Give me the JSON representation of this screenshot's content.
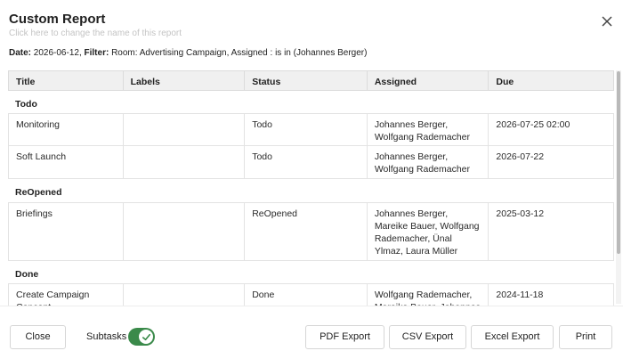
{
  "dialog": {
    "title": "Custom Report",
    "subtitle": "Click here to change the name of this report",
    "close_icon": "close-icon"
  },
  "filter": {
    "date_label": "Date:",
    "date_value": "2026-06-12,",
    "filter_label": "Filter:",
    "filter_value": "Room: Advertising Campaign, Assigned : is in (Johannes Berger)"
  },
  "table": {
    "columns": [
      "Title",
      "Labels",
      "Status",
      "Assigned",
      "Due"
    ],
    "groups": [
      {
        "name": "Todo",
        "rows": [
          {
            "title": "Monitoring",
            "labels": "",
            "status": "Todo",
            "assigned": "Johannes Berger, Wolfgang Rademacher",
            "due": "2026-07-25 02:00"
          },
          {
            "title": "Soft Launch",
            "labels": "",
            "status": "Todo",
            "assigned": "Johannes Berger, Wolfgang Rademacher",
            "due": "2026-07-22"
          }
        ]
      },
      {
        "name": "ReOpened",
        "rows": [
          {
            "title": "Briefings",
            "labels": "",
            "status": "ReOpened",
            "assigned": "Johannes Berger, Mareike Bauer, Wolfgang Rademacher, Ünal Ylmaz, Laura Müller",
            "due": "2025-03-12"
          }
        ]
      },
      {
        "name": "Done",
        "rows": [
          {
            "title": "Create Campaign Concept",
            "labels": "",
            "status": "Done",
            "assigned": "Wolfgang Rademacher, Mareike Bauer, Johannes",
            "due": "2024-11-18"
          }
        ]
      }
    ]
  },
  "footer": {
    "close_label": "Close",
    "subtasks_label": "Subtasks",
    "subtasks_enabled": true,
    "pdf_label": "PDF Export",
    "csv_label": "CSV Export",
    "excel_label": "Excel Export",
    "print_label": "Print"
  },
  "colors": {
    "toggle_on": "#3a8a4a",
    "header_bg": "#f0f0f0"
  }
}
